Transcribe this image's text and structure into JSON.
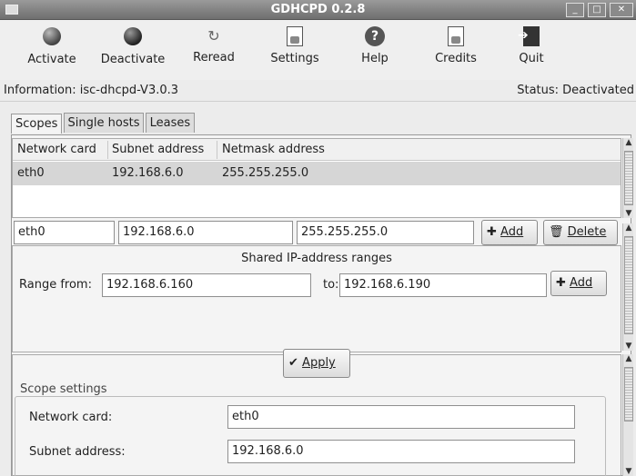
{
  "window": {
    "title": "GDHCPD 0.2.8"
  },
  "toolbar": {
    "items": [
      {
        "label": "Activate",
        "icon": "activate-icon"
      },
      {
        "label": "Deactivate",
        "icon": "deactivate-icon"
      },
      {
        "label": "Reread",
        "icon": "reread-icon"
      },
      {
        "label": "Settings",
        "icon": "settings-icon"
      },
      {
        "label": "Help",
        "icon": "help-icon"
      },
      {
        "label": "Credits",
        "icon": "credits-icon"
      },
      {
        "label": "Quit",
        "icon": "quit-icon"
      }
    ]
  },
  "info": {
    "left": "Information: isc-dhcpd-V3.0.3",
    "right": "Status: Deactivated"
  },
  "tabs": [
    {
      "label": "Scopes",
      "active": true
    },
    {
      "label": "Single hosts"
    },
    {
      "label": "Leases"
    }
  ],
  "scopes_table": {
    "columns": [
      "Network card",
      "Subnet address",
      "Netmask address"
    ],
    "rows": [
      [
        "eth0",
        "192.168.6.0",
        "255.255.255.0"
      ]
    ]
  },
  "scope_entry": {
    "network_card": "eth0",
    "subnet": "192.168.6.0",
    "netmask": "255.255.255.0",
    "add_label": "Add",
    "delete_label": "Delete"
  },
  "ranges": {
    "title": "Shared IP-address ranges",
    "from_label": "Range from:",
    "from_value": "192.168.6.160",
    "to_label": "to:",
    "to_value": "192.168.6.190",
    "add_label": "Add"
  },
  "apply_label": "Apply",
  "scope_settings": {
    "legend": "Scope settings",
    "network_card_label": "Network card:",
    "network_card_value": "eth0",
    "subnet_label": "Subnet address:",
    "subnet_value": "192.168.6.0"
  }
}
